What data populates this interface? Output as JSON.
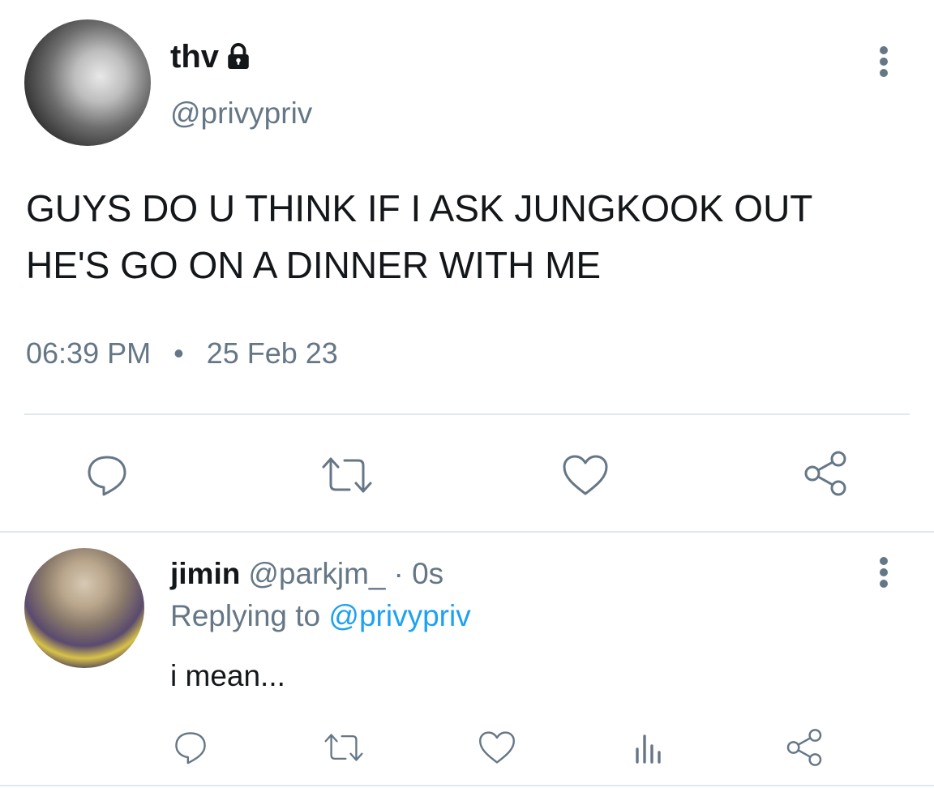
{
  "main_tweet": {
    "display_name": "thv",
    "handle": "@privypriv",
    "text": "GUYS DO U THINK IF I ASK JUNGKOOK OUT\nHE'S GO ON A DINNER WITH ME",
    "time": "06:39 PM",
    "separator": "•",
    "date": "25 Feb 23",
    "actions": [
      "reply-icon",
      "retweet-icon",
      "like-icon",
      "share-icon"
    ]
  },
  "reply": {
    "display_name": "jimin",
    "handle": "@parkjm_",
    "time": "· 0s",
    "replying_prefix": "Replying to",
    "replying_to": "@privypriv",
    "text": "i mean...",
    "actions": [
      "reply-icon",
      "retweet-icon",
      "like-icon",
      "analytics-icon",
      "share-icon"
    ]
  },
  "colors": {
    "text": "#14171a",
    "secondary": "#657786",
    "link": "#1da1f2",
    "divider": "#e1e8ed"
  }
}
